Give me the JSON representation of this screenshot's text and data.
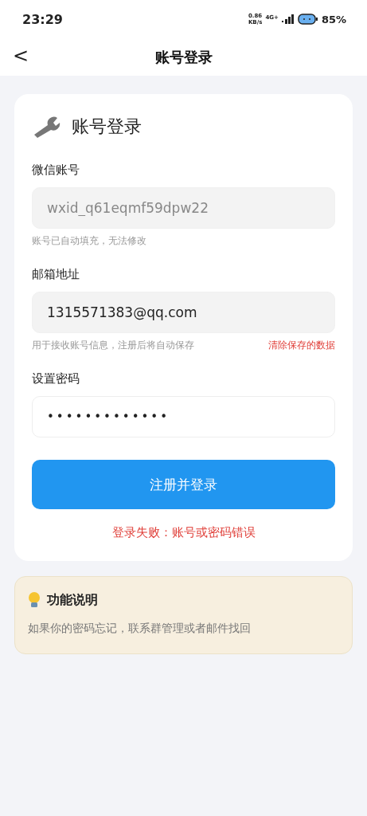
{
  "status_bar": {
    "time": "23:29",
    "speed": "0.86",
    "speed_unit": "KB/s",
    "network": "4G+",
    "battery": "85%"
  },
  "header": {
    "back": "<",
    "title": "账号登录"
  },
  "card": {
    "title": "账号登录",
    "fields": [
      {
        "kind": "readonly",
        "label": "微信账号",
        "value": "wxid_q61eqmf59dpw22",
        "disabled": true,
        "hint": "账号已自动填充，无法修改"
      },
      {
        "kind": "email",
        "label": "邮箱地址",
        "value": "1315571383@qq.com",
        "disabled": false,
        "hint": "用于接收账号信息，注册后将自动保存",
        "link": "清除保存的数据"
      },
      {
        "kind": "password",
        "label": "设置密码",
        "value": "•••••••••••••",
        "disabled": false
      }
    ],
    "submit": "注册并登录",
    "error": "登录失败：账号或密码错误"
  },
  "tip": {
    "title": "功能说明",
    "text": "如果你的密码忘记，联系群管理或者邮件找回"
  }
}
